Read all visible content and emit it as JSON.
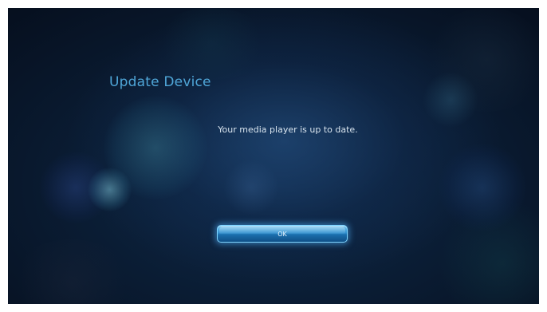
{
  "dialog": {
    "title": "Update Device",
    "message": "Your media player is up to date.",
    "ok_label": "OK"
  },
  "colors": {
    "title": "#4fa6d8",
    "background": "#0a1c33",
    "button": "#2f8fcf",
    "message": "#d8e4ee"
  }
}
